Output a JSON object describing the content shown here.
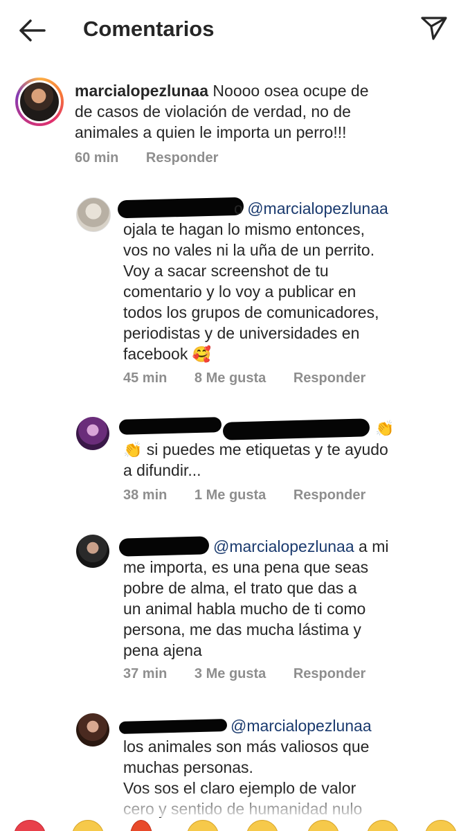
{
  "header": {
    "title": "Comentarios",
    "back_icon": "arrow-left-icon",
    "share_icon": "paper-plane-icon"
  },
  "main_comment": {
    "username": "marcialopezlunaa",
    "text": "Noooo osea ocupe de\nde casos de violación de verdad, no de\nanimales a quien le importa un perro!!!",
    "time": "60 min",
    "reply_label": "Responder"
  },
  "replies": [
    {
      "username_tail": "o",
      "mention": "@marcialopezlunaa",
      "text": "ojala te hagan lo mismo entonces,\nvos no vales ni la uña de un perrito.\nVoy a sacar screenshot de tu\ncomentario y lo voy a publicar en\ntodos los grupos de comunicadores,\nperiodistas y de universidades en\nfacebook ",
      "emoji": "🥰",
      "time": "45 min",
      "likes": "8 Me gusta",
      "reply_label": "Responder"
    },
    {
      "emoji_start": "👏",
      "text": " si puedes me etiquetas y te ayudo\na difundir...",
      "emoji_end": "👏",
      "time": "38 min",
      "likes": "1 Me gusta",
      "reply_label": "Responder"
    },
    {
      "mention": "@marcialopezlunaa",
      "text_head": " a mi",
      "text": "me importa, es una pena que seas\npobre de alma, el trato que das a\nun animal habla mucho de ti como\npersona, me das mucha lástima y\npena ajena",
      "time": "37 min",
      "likes": "3 Me gusta",
      "reply_label": "Responder"
    },
    {
      "mention": "@marcialopezlunaa",
      "text": "los animales son más valiosos que\nmuchas personas.\nVos sos el claro ejemplo de valor\ncero y sentido de humanidad nulo"
    }
  ],
  "colors": {
    "mention": "#1a3a6e",
    "meta": "#8e8e8e",
    "text": "#262626"
  }
}
